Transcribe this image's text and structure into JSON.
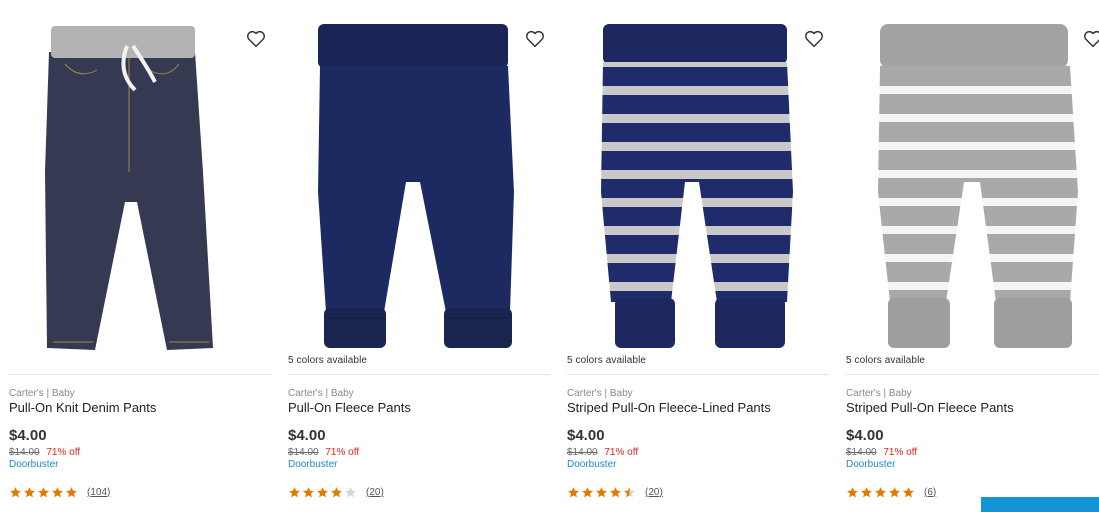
{
  "colors": {
    "star_filled": "#e07b00",
    "star_empty": "#d6d6d6",
    "sale": "#e2231a",
    "badge": "#1a8ccb",
    "chat": "#1493d6"
  },
  "products": [
    {
      "image_icon": "pants-denim-icon",
      "colors_available": "",
      "brand": "Carter's | Baby",
      "title": "Pull-On Knit Denim Pants",
      "price": "$4.00",
      "was_price": "$14.00",
      "discount": "71% off",
      "badge": "Doorbuster",
      "rating": 5,
      "review_count": "(104)"
    },
    {
      "image_icon": "pants-navy-icon",
      "colors_available": "5 colors available",
      "brand": "Carter's | Baby",
      "title": "Pull-On Fleece Pants",
      "price": "$4.00",
      "was_price": "$14.00",
      "discount": "71% off",
      "badge": "Doorbuster",
      "rating": 4,
      "review_count": "(20)"
    },
    {
      "image_icon": "pants-navy-stripe-icon",
      "colors_available": "5 colors available",
      "brand": "Carter's | Baby",
      "title": "Striped Pull-On Fleece-Lined Pants",
      "price": "$4.00",
      "was_price": "$14.00",
      "discount": "71% off",
      "badge": "Doorbuster",
      "rating": 4.5,
      "review_count": "(20)"
    },
    {
      "image_icon": "pants-gray-stripe-icon",
      "colors_available": "5 colors available",
      "brand": "Carter's | Baby",
      "title": "Striped Pull-On Fleece Pants",
      "price": "$4.00",
      "was_price": "$14.00",
      "discount": "71% off",
      "badge": "Doorbuster",
      "rating": 5,
      "review_count": "(6)"
    }
  ]
}
